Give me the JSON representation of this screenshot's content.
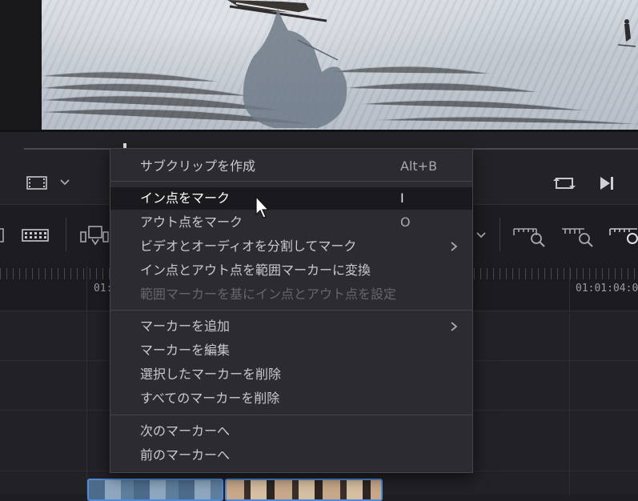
{
  "viewer": {
    "timeline_timecodes": [
      "01:",
      "01:01:04:00"
    ]
  },
  "context_menu": {
    "groups": [
      [
        {
          "label": "サブクリップを作成",
          "shortcut": "Alt+B",
          "state": "normal",
          "submenu": false
        }
      ],
      [
        {
          "label": "イン点をマーク",
          "shortcut": "I",
          "state": "highlighted",
          "submenu": false
        },
        {
          "label": "アウト点をマーク",
          "shortcut": "O",
          "state": "normal",
          "submenu": false
        },
        {
          "label": "ビデオとオーディオを分割してマーク",
          "shortcut": "",
          "state": "normal",
          "submenu": true
        },
        {
          "label": "イン点とアウト点を範囲マーカーに変換",
          "shortcut": "",
          "state": "normal",
          "submenu": false
        },
        {
          "label": "範囲マーカーを基にイン点とアウト点を設定",
          "shortcut": "",
          "state": "disabled",
          "submenu": false
        }
      ],
      [
        {
          "label": "マーカーを追加",
          "shortcut": "",
          "state": "normal",
          "submenu": true
        },
        {
          "label": "マーカーを編集",
          "shortcut": "",
          "state": "normal",
          "submenu": false
        },
        {
          "label": "選択したマーカーを削除",
          "shortcut": "",
          "state": "normal",
          "submenu": false
        },
        {
          "label": "すべてのマーカーを削除",
          "shortcut": "",
          "state": "normal",
          "submenu": false
        }
      ],
      [
        {
          "label": "次のマーカーへ",
          "shortcut": "",
          "state": "normal",
          "submenu": false
        },
        {
          "label": "前のマーカーへ",
          "shortcut": "",
          "state": "normal",
          "submenu": false
        }
      ]
    ]
  },
  "colors": {
    "menu_bg": "#2b2b31",
    "highlight_bg": "#1a1a1e",
    "clip_selected_border": "#4f8bd6",
    "text_normal": "#c9c9ce",
    "text_disabled": "#66666d"
  },
  "icons": [
    "clip-view-icon",
    "chevron-down-icon",
    "loop-icon",
    "skip-to-end-icon",
    "blade-icon",
    "insert-clip-icon",
    "zoom-full-icon",
    "zoom-detail-icon",
    "zoom-custom-icon",
    "submenu-arrow-icon",
    "mouse-cursor-icon"
  ]
}
